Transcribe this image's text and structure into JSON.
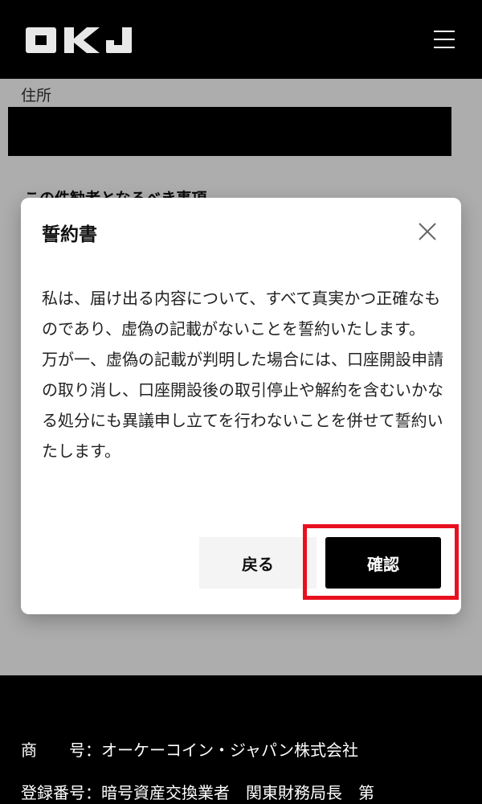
{
  "header": {
    "logo_text": "OKJ",
    "menu_icon": "hamburger-menu-icon"
  },
  "form": {
    "address_label": "住所",
    "section_heading": "この件勧者となるべき事項"
  },
  "modal": {
    "title": "誓約書",
    "close_icon": "close-icon",
    "body": [
      "私は、届け出る内容について、すべて真実かつ正確なものであり、虚偽の記載がないことを誓約いたします。",
      "万が一、虚偽の記載が判明した場合には、口座開設申請の取り消し、口座開設後の取引停止や解約を含むいかなる処分にも異議申し立てを行わないことを併せて誓約いたします。"
    ],
    "back_label": "戻る",
    "confirm_label": "確認"
  },
  "footer": {
    "trade_name": "商　　号：オーケーコイン・ジャパン株式会社",
    "registration": "登録番号：暗号資産交換業者　関東財務局長　第"
  },
  "colors": {
    "highlight": "#e8101e",
    "accent": "#000000"
  }
}
